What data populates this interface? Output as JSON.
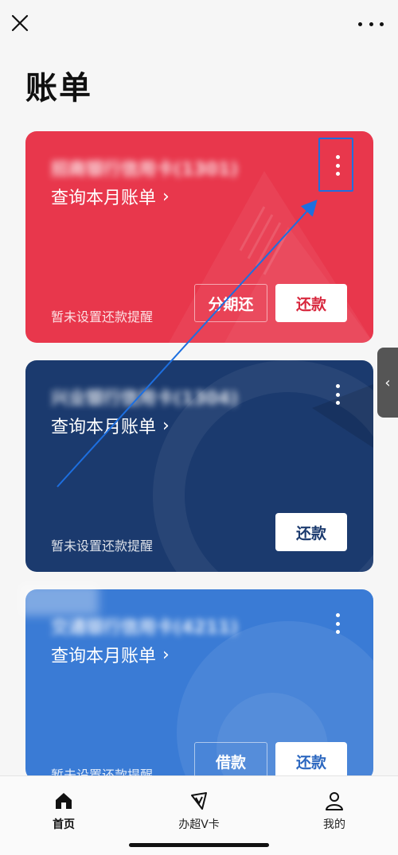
{
  "page": {
    "title": "账单"
  },
  "cards": [
    {
      "bank_name": "招商银行信用卡(1301)",
      "query_label": "查询本月账单",
      "reminder": "暂未设置还款提醒",
      "secondary_button": "分期还",
      "primary_button": "还款",
      "color": "#e8374c",
      "button_text_color": "#d8283e"
    },
    {
      "bank_name": "兴业银行信用卡(1304)",
      "query_label": "查询本月账单",
      "reminder": "暂未设置还款提醒",
      "primary_button": "还款",
      "color": "#1b3a6e",
      "button_text_color": "#1b3a6e"
    },
    {
      "bank_name": "交通银行信用卡(4211)",
      "query_label": "查询本月账单",
      "reminder": "暂未设置还款提醒",
      "secondary_button": "借款",
      "primary_button": "还款",
      "color": "#3a7bd5",
      "button_text_color": "#2d68c0"
    }
  ],
  "nav": [
    {
      "label": "首页",
      "icon": "home-icon",
      "active": true
    },
    {
      "label": "办超V卡",
      "icon": "v-card-icon",
      "active": false
    },
    {
      "label": "我的",
      "icon": "user-icon",
      "active": false
    }
  ],
  "icons": {
    "close": "close-icon",
    "more": "more-horizontal-icon",
    "card_more": "more-vertical-icon",
    "side_tab": "chevron-left-icon"
  },
  "colors": {
    "annotation": "#1d6fe0"
  }
}
